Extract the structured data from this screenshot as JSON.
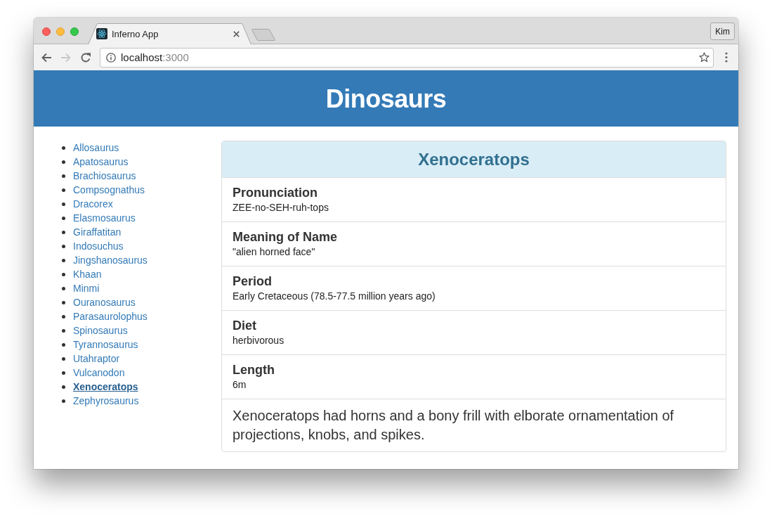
{
  "browser": {
    "tabs": [
      {
        "label": "Inferno App",
        "selected": true
      }
    ],
    "profile": "Kim",
    "nav_buttons": [
      {
        "kind": "back",
        "disabled": false
      },
      {
        "kind": "forward",
        "disabled": true
      },
      {
        "kind": "reload",
        "disabled": false
      }
    ],
    "address": {
      "host": "localhost",
      "port": ":3000"
    }
  },
  "header": {
    "title": "Dinosaurs"
  },
  "sidebar": {
    "items": [
      {
        "label": "Allosaurus",
        "selected": false
      },
      {
        "label": "Apatosaurus",
        "selected": false
      },
      {
        "label": "Brachiosaurus",
        "selected": false
      },
      {
        "label": "Compsognathus",
        "selected": false
      },
      {
        "label": "Dracorex",
        "selected": false
      },
      {
        "label": "Elasmosaurus",
        "selected": false
      },
      {
        "label": "Giraffatitan",
        "selected": false
      },
      {
        "label": "Indosuchus",
        "selected": false
      },
      {
        "label": "Jingshanosaurus",
        "selected": false
      },
      {
        "label": "Khaan",
        "selected": false
      },
      {
        "label": "Minmi",
        "selected": false
      },
      {
        "label": "Ouranosaurus",
        "selected": false
      },
      {
        "label": "Parasaurolophus",
        "selected": false
      },
      {
        "label": "Spinosaurus",
        "selected": false
      },
      {
        "label": "Tyrannosaurus",
        "selected": false
      },
      {
        "label": "Utahraptor",
        "selected": false
      },
      {
        "label": "Vulcanodon",
        "selected": false
      },
      {
        "label": "Xenoceratops",
        "selected": true
      },
      {
        "label": "Zephyrosaurus",
        "selected": false
      }
    ]
  },
  "detail": {
    "title": "Xenoceratops",
    "fields": [
      {
        "label": "Pronunciation",
        "value": "ZEE-no-SEH-ruh-tops"
      },
      {
        "label": "Meaning of Name",
        "value": "\"alien horned face\""
      },
      {
        "label": "Period",
        "value": "Early Cretaceous (78.5-77.5 million years ago)"
      },
      {
        "label": "Diet",
        "value": "herbivorous"
      },
      {
        "label": "Length",
        "value": "6m"
      }
    ],
    "description": "Xenoceratops had horns and a bony frill with elborate ornamentation of projections, knobs, and spikes."
  }
}
